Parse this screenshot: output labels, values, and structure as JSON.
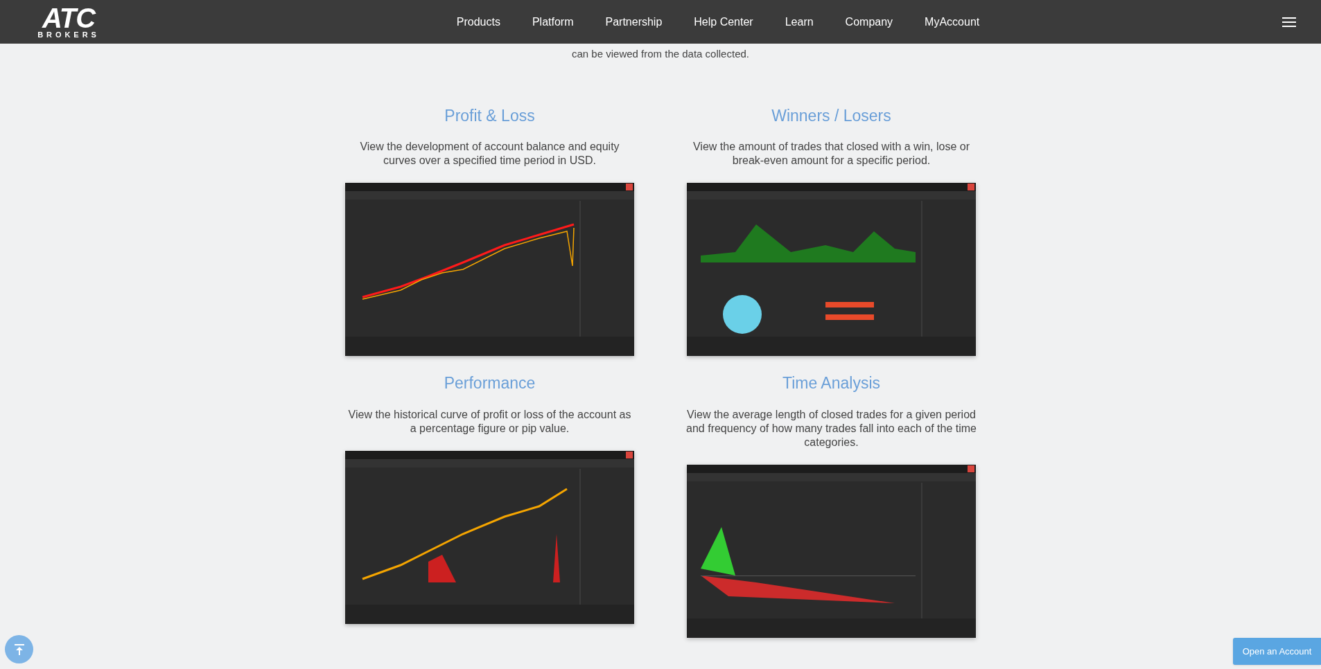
{
  "header": {
    "logo": {
      "text": "ATC",
      "subtext": "BROKERS"
    },
    "nav": [
      {
        "label": "Products"
      },
      {
        "label": "Platform"
      },
      {
        "label": "Partnership"
      },
      {
        "label": "Help Center"
      },
      {
        "label": "Learn"
      },
      {
        "label": "Company"
      },
      {
        "label": "MyAccount"
      }
    ]
  },
  "intro": "can be viewed from the data collected.",
  "features": [
    {
      "title": "Profit & Loss",
      "description": "View the development of account balance and equity curves over a specified time period in USD."
    },
    {
      "title": "Winners / Losers",
      "description": "View the amount of trades that closed with a win, lose or break-even amount for a specific period."
    },
    {
      "title": "Performance",
      "description": "View the historical curve of profit or loss of the account as a percentage figure or pip value."
    },
    {
      "title": "Time Analysis",
      "description": "View the average length of closed trades for a given period and frequency of how many trades fall into each of the time categories."
    }
  ],
  "open_account": "Open an Account"
}
